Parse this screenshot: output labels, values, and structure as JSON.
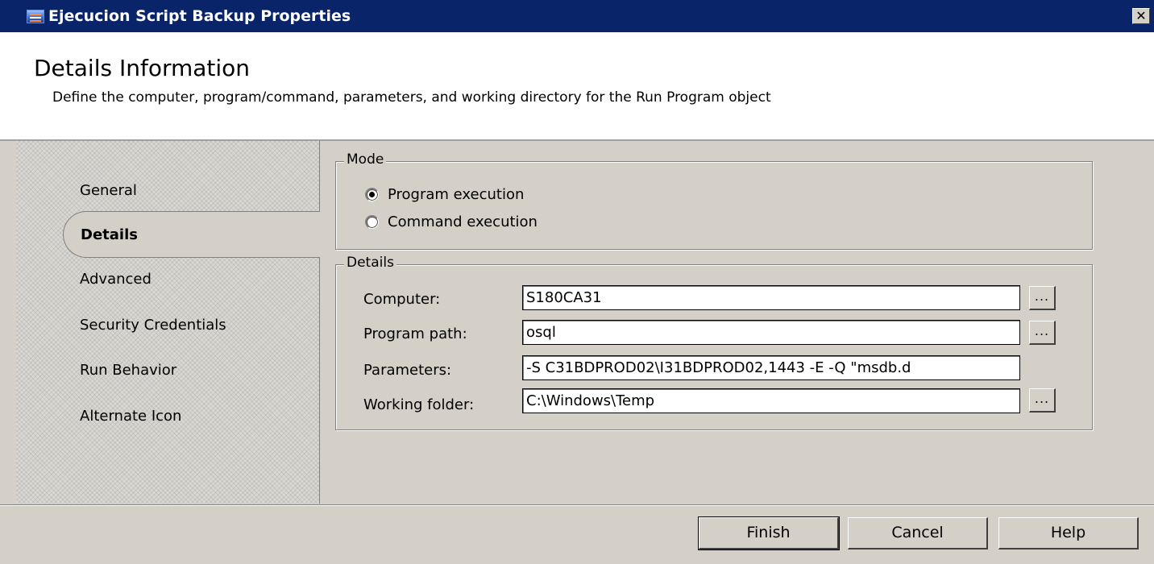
{
  "window": {
    "title": "Ejecucion Script Backup Properties",
    "app_icon": "properties-window-icon",
    "close_label": "✕"
  },
  "header": {
    "title": "Details Information",
    "description": "Define the computer, program/command, parameters, and working directory for the Run Program object"
  },
  "sidebar": {
    "items": [
      {
        "label": "General",
        "selected": false
      },
      {
        "label": "Details",
        "selected": true
      },
      {
        "label": "Advanced",
        "selected": false
      },
      {
        "label": "Security Credentials",
        "selected": false
      },
      {
        "label": "Run Behavior",
        "selected": false
      },
      {
        "label": "Alternate Icon",
        "selected": false
      }
    ]
  },
  "mode": {
    "legend": "Mode",
    "options": [
      {
        "label": "Program execution",
        "checked": true
      },
      {
        "label": "Command execution",
        "checked": false
      }
    ]
  },
  "details": {
    "legend": "Details",
    "fields": [
      {
        "label": "Computer:",
        "value": "S180CA31",
        "has_browse": true
      },
      {
        "label": "Program path:",
        "value": "osql",
        "has_browse": true
      },
      {
        "label": "Parameters:",
        "value": "-S C31BDPROD02\\I31BDPROD02,1443 -E -Q \"msdb.d",
        "has_browse": false
      },
      {
        "label": "Working folder:",
        "value": "C:\\Windows\\Temp",
        "has_browse": true
      }
    ],
    "browse_label": "..."
  },
  "footer": {
    "finish_label": "Finish",
    "cancel_label": "Cancel",
    "help_label": "Help"
  }
}
